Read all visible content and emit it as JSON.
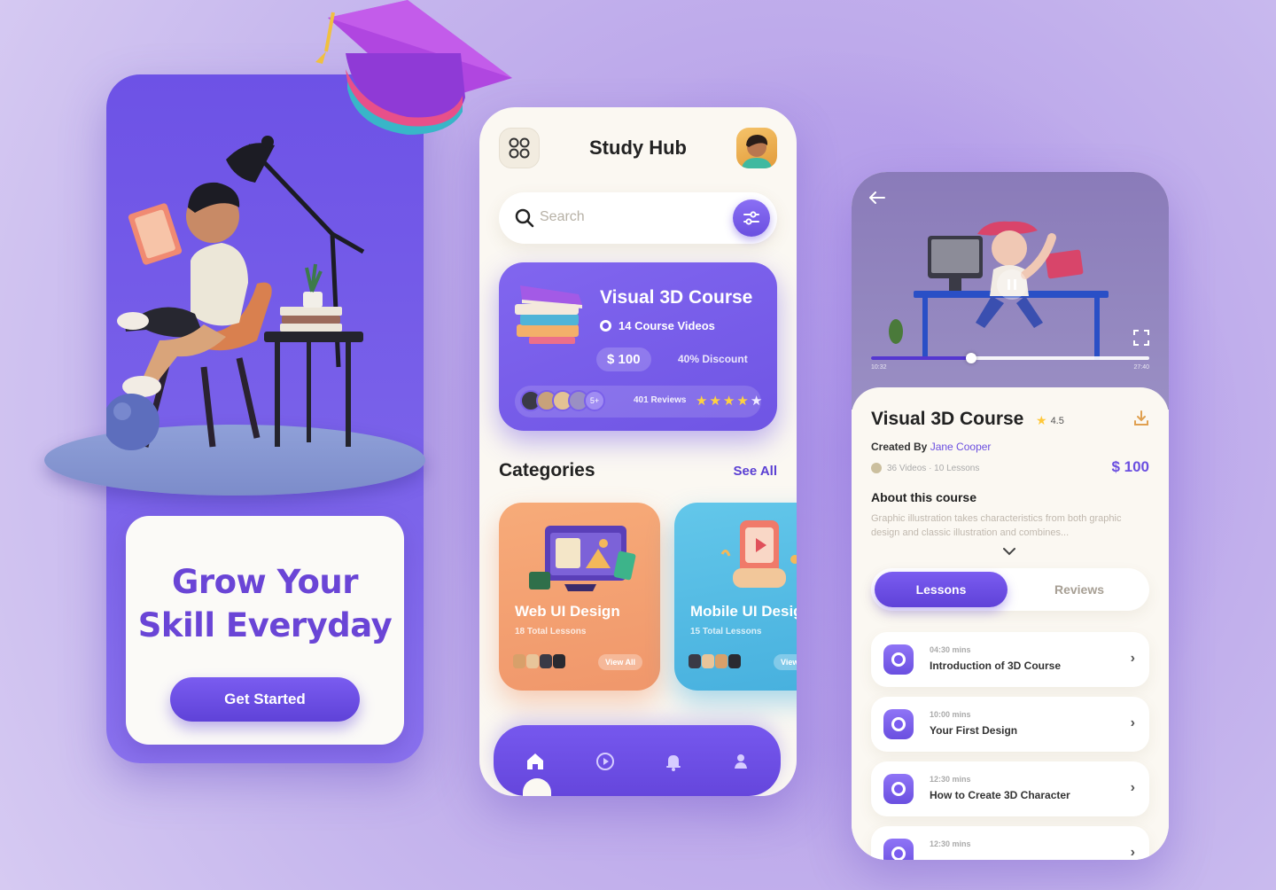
{
  "colors": {
    "brand_purple": "#6f55e4",
    "accent_orange": "#f0976b",
    "accent_blue": "#47b0de",
    "star_yellow": "#ffd23f",
    "background": "#c3b0ee"
  },
  "onboarding": {
    "headline_line1": "Grow Your",
    "headline_line2": "Skill Everyday",
    "cta_label": "Get Started"
  },
  "home": {
    "app_title": "Study Hub",
    "menu_icon": "grid-icon",
    "search": {
      "placeholder": "Search",
      "filter_icon": "filter-icon"
    },
    "featured_course": {
      "title": "Visual 3D Course",
      "videos": "14 Course Videos",
      "price": "$ 100",
      "discount": "40% Discount",
      "reviews": "401 Reviews",
      "rating_stars": 5,
      "more_avatars": "5+"
    },
    "categories_title": "Categories",
    "see_all_label": "See All",
    "categories": [
      {
        "name": "Web UI Design",
        "lessons": "18 Total Lessons",
        "tag": "View All"
      },
      {
        "name": "Mobile UI Design",
        "lessons": "15 Total Lessons",
        "tag": "View"
      }
    ],
    "nav": [
      {
        "icon": "home-icon",
        "active": true
      },
      {
        "icon": "play-icon",
        "active": false
      },
      {
        "icon": "bell-icon",
        "active": false
      },
      {
        "icon": "profile-icon",
        "active": false
      }
    ]
  },
  "detail": {
    "title": "Visual 3D Course",
    "rating": "4.5",
    "created_by_label": "Created By",
    "author": "Jane Cooper",
    "meta": "36 Videos · 10 Lessons",
    "price": "$ 100",
    "about_title": "About this course",
    "about_text": "Graphic illustration takes characteristics from both graphic design and classic illustration and combines...",
    "video_progress": 0.36,
    "time_elapsed": "10:32",
    "time_total": "27:40",
    "tabs": [
      {
        "label": "Lessons",
        "active": true
      },
      {
        "label": "Reviews",
        "active": false
      }
    ],
    "lessons": [
      {
        "duration": "04:30 mins",
        "title": "Introduction of 3D Course"
      },
      {
        "duration": "10:00 mins",
        "title": "Your First Design"
      },
      {
        "duration": "12:30 mins",
        "title": "How to Create 3D Character"
      },
      {
        "duration": "12:30 mins",
        "title": ""
      }
    ]
  }
}
